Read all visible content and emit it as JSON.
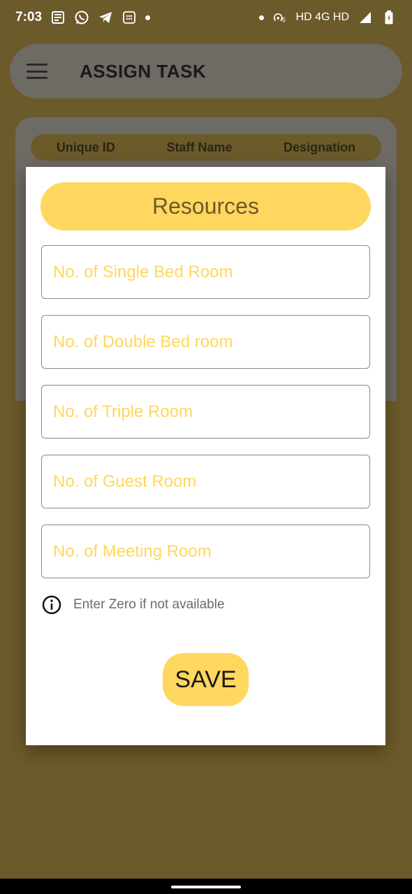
{
  "status_bar": {
    "time": "7:03",
    "network_text": "HD 4G HD",
    "icons": [
      "news-icon",
      "whatsapp-icon",
      "telegram-icon",
      "calculator-icon",
      "hotspot-icon",
      "signal-icon",
      "battery-icon"
    ]
  },
  "app_bar": {
    "title": "ASSIGN TASK"
  },
  "table": {
    "headers": [
      "Unique ID",
      "Staff Name",
      "Designation"
    ]
  },
  "dialog": {
    "title": "Resources",
    "fields": [
      {
        "placeholder": "No. of Single Bed Room",
        "value": ""
      },
      {
        "placeholder": "No. of Double Bed room",
        "value": ""
      },
      {
        "placeholder": "No. of Triple Room",
        "value": ""
      },
      {
        "placeholder": "No. of Guest Room",
        "value": ""
      },
      {
        "placeholder": "No. of Meeting Room",
        "value": ""
      }
    ],
    "hint": "Enter Zero if not available",
    "save_label": "SAVE"
  },
  "colors": {
    "accent": "#ffd75e",
    "scrim": "#6b5a2a",
    "placeholder": "#ffd75e"
  }
}
